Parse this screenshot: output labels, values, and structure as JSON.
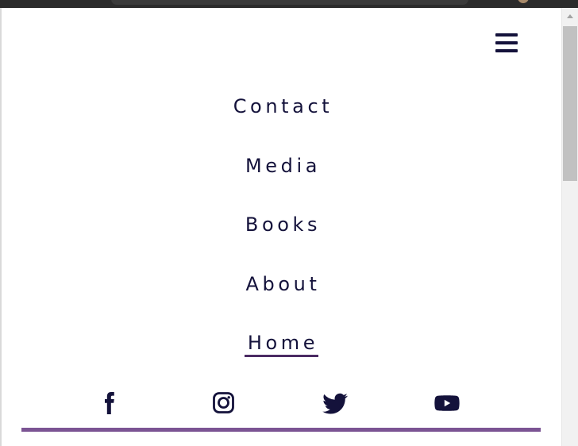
{
  "nav": {
    "items": [
      {
        "label": "Contact",
        "active": false
      },
      {
        "label": "Media",
        "active": false
      },
      {
        "label": "Books",
        "active": false
      },
      {
        "label": "About",
        "active": false
      },
      {
        "label": "Home",
        "active": true
      }
    ]
  },
  "social": {
    "icons": [
      "facebook-icon",
      "instagram-icon",
      "twitter-icon",
      "youtube-icon"
    ]
  },
  "colors": {
    "text": "#14123b",
    "accent": "#7b5493",
    "underline": "#4b2b63",
    "scrollbar_track": "#f1f1f1",
    "scrollbar_thumb": "#c1c1c1"
  }
}
